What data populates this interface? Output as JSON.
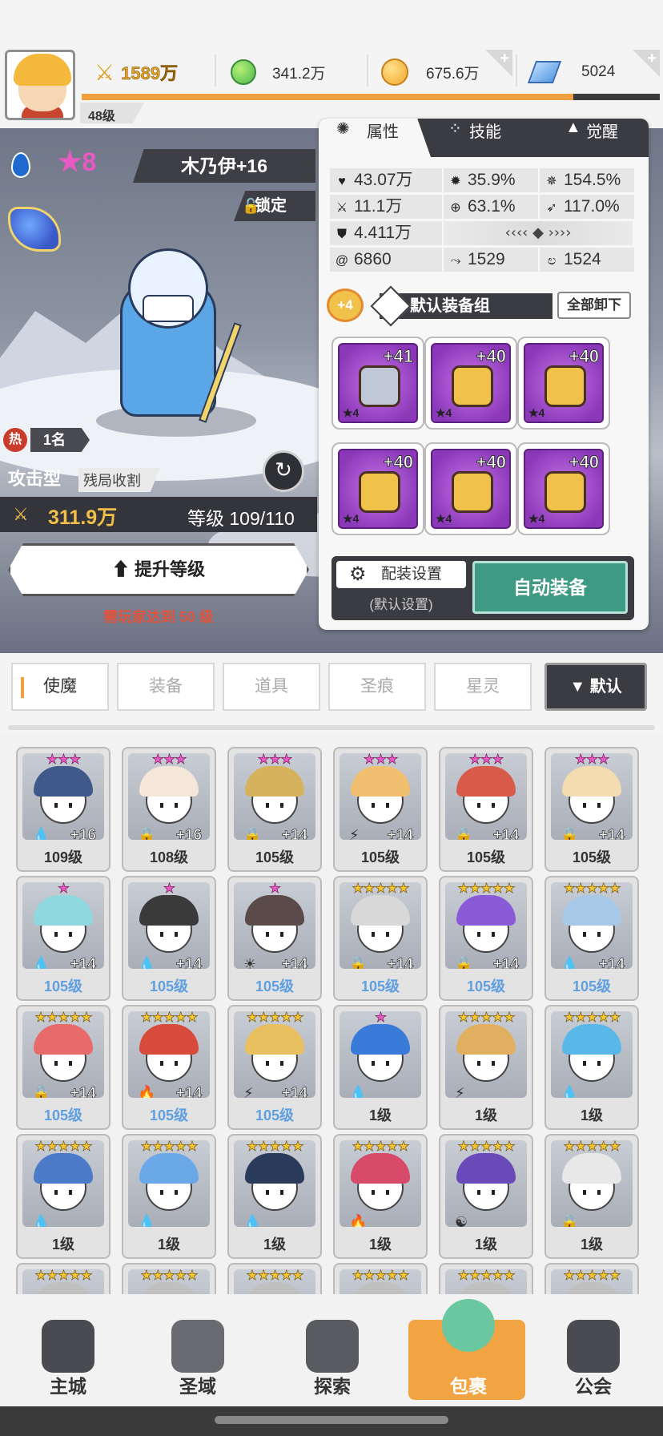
{
  "header": {
    "player_level": "48级",
    "power": "1589万",
    "green_gem": "341.2万",
    "gold": "675.6万",
    "crystal": "5024",
    "xp_progress": 0.85
  },
  "hero": {
    "stars": "8",
    "name": "木乃伊+16",
    "lock_label": "锁定",
    "rank_hot": "热",
    "rank": "1名",
    "type": "攻击型",
    "trait": "残局收割",
    "power": "311.9万",
    "level_label": "等级",
    "level": "109/110",
    "upgrade_button": "提升等级",
    "upgrade_note": "需玩家达到 50 级"
  },
  "panel": {
    "tabs": [
      "属性",
      "技能",
      "觉醒"
    ],
    "stats": {
      "hp": "43.07万",
      "crit": "35.9%",
      "crit_dmg": "154.5%",
      "atk": "11.1万",
      "hit": "63.1%",
      "speed": "117.0%",
      "def": "4.411万",
      "s1": "6860",
      "s2": "1529",
      "s3": "1524"
    },
    "set_badge": "+4",
    "set_name": "默认装备组",
    "unequip_all": "全部卸下",
    "equipment": [
      {
        "plus": "+41",
        "stars": "★4",
        "icon": "sword-icon"
      },
      {
        "plus": "+40",
        "stars": "★4",
        "icon": "helmet-icon"
      },
      {
        "plus": "+40",
        "stars": "★4",
        "icon": "armor-icon"
      },
      {
        "plus": "+40",
        "stars": "★4",
        "icon": "belt-icon"
      },
      {
        "plus": "+40",
        "stars": "★4",
        "icon": "necklace-icon"
      },
      {
        "plus": "+40",
        "stars": "★4",
        "icon": "boots-icon"
      }
    ],
    "config_button": "配装设置",
    "config_sub": "(默认设置)",
    "auto_equip": "自动装备"
  },
  "categories": [
    "使魔",
    "装备",
    "道具",
    "圣痕",
    "星灵"
  ],
  "sort_label": "▼ 默认",
  "heroes": [
    {
      "stars": "★★★",
      "pink": true,
      "plus": "+16",
      "level": "109级",
      "hair": "#3f5a8a",
      "elem": "💧"
    },
    {
      "stars": "★★★",
      "pink": true,
      "plus": "+16",
      "level": "108级",
      "hair": "#f4e6d8",
      "elem": "🔒"
    },
    {
      "stars": "★★★",
      "pink": true,
      "plus": "+14",
      "level": "105级",
      "hair": "#d6b25c",
      "elem": "🔒"
    },
    {
      "stars": "★★★",
      "pink": true,
      "plus": "+14",
      "level": "105级",
      "hair": "#f0c070",
      "elem": "⚡"
    },
    {
      "stars": "★★★",
      "pink": true,
      "plus": "+14",
      "level": "105级",
      "hair": "#d85a4a",
      "elem": "🔒"
    },
    {
      "stars": "★★★",
      "pink": true,
      "plus": "+14",
      "level": "105级",
      "hair": "#f2dcb0",
      "elem": "🔒"
    },
    {
      "stars": "★",
      "pink": true,
      "plus": "+14",
      "level": "105级",
      "hair": "#8fd8e0",
      "elem": "💧",
      "blue": true
    },
    {
      "stars": "★",
      "pink": true,
      "plus": "+14",
      "level": "105级",
      "hair": "#3a3a3a",
      "elem": "💧",
      "blue": true
    },
    {
      "stars": "★",
      "pink": true,
      "plus": "+14",
      "level": "105级",
      "hair": "#5a4a4a",
      "elem": "☀",
      "blue": true
    },
    {
      "stars": "★★★★★",
      "pink": false,
      "plus": "+14",
      "level": "105级",
      "hair": "#d8d8d8",
      "elem": "🔒",
      "blue": true
    },
    {
      "stars": "★★★★★",
      "pink": false,
      "plus": "+14",
      "level": "105级",
      "hair": "#8a5ad8",
      "elem": "🔒",
      "blue": true
    },
    {
      "stars": "★★★★★",
      "pink": false,
      "plus": "+14",
      "level": "105级",
      "hair": "#a8c8e8",
      "elem": "💧",
      "blue": true
    },
    {
      "stars": "★★★★★",
      "pink": false,
      "plus": "+14",
      "level": "105级",
      "hair": "#e86a6a",
      "elem": "🔒",
      "blue": true
    },
    {
      "stars": "★★★★★",
      "pink": false,
      "plus": "+14",
      "level": "105级",
      "hair": "#d84a3a",
      "elem": "🔥",
      "blue": true
    },
    {
      "stars": "★★★★★",
      "pink": false,
      "plus": "+14",
      "level": "105级",
      "hair": "#e8c060",
      "elem": "⚡",
      "blue": true
    },
    {
      "stars": "★",
      "pink": true,
      "plus": "",
      "level": "1级",
      "hair": "#3a7ad8",
      "elem": "💧"
    },
    {
      "stars": "★★★★★",
      "pink": false,
      "plus": "",
      "level": "1级",
      "hair": "#e0b060",
      "elem": "⚡"
    },
    {
      "stars": "★★★★★",
      "pink": false,
      "plus": "",
      "level": "1级",
      "hair": "#5ab8e8",
      "elem": "💧"
    },
    {
      "stars": "★★★★★",
      "pink": false,
      "plus": "",
      "level": "1级",
      "hair": "#4a7ac8",
      "elem": "💧"
    },
    {
      "stars": "★★★★★",
      "pink": false,
      "plus": "",
      "level": "1级",
      "hair": "#6aa8e8",
      "elem": "💧"
    },
    {
      "stars": "★★★★★",
      "pink": false,
      "plus": "",
      "level": "1级",
      "hair": "#2a3a5a",
      "elem": "💧"
    },
    {
      "stars": "★★★★★",
      "pink": false,
      "plus": "",
      "level": "1级",
      "hair": "#d84a6a",
      "elem": "🔥"
    },
    {
      "stars": "★★★★★",
      "pink": false,
      "plus": "",
      "level": "1级",
      "hair": "#6a4ab8",
      "elem": "☯"
    },
    {
      "stars": "★★★★★",
      "pink": false,
      "plus": "",
      "level": "1级",
      "hair": "#e8e8e8",
      "elem": "🔒"
    },
    {
      "stars": "★★★★★",
      "pink": false,
      "plus": "",
      "level": "",
      "hair": "#c0c0c0",
      "elem": ""
    },
    {
      "stars": "★★★★★",
      "pink": false,
      "plus": "",
      "level": "",
      "hair": "#c0c0c0",
      "elem": ""
    },
    {
      "stars": "★★★★★",
      "pink": false,
      "plus": "",
      "level": "",
      "hair": "#c0c0c0",
      "elem": ""
    },
    {
      "stars": "★★★★★",
      "pink": false,
      "plus": "",
      "level": "",
      "hair": "#c0c0c0",
      "elem": ""
    },
    {
      "stars": "★★★★★",
      "pink": false,
      "plus": "",
      "level": "",
      "hair": "#c0c0c0",
      "elem": ""
    },
    {
      "stars": "★★★★★",
      "pink": false,
      "plus": "",
      "level": "",
      "hair": "#c0c0c0",
      "elem": ""
    }
  ],
  "nav": [
    "主城",
    "圣域",
    "探索",
    "包裹",
    "公会"
  ],
  "nav_active": 3
}
